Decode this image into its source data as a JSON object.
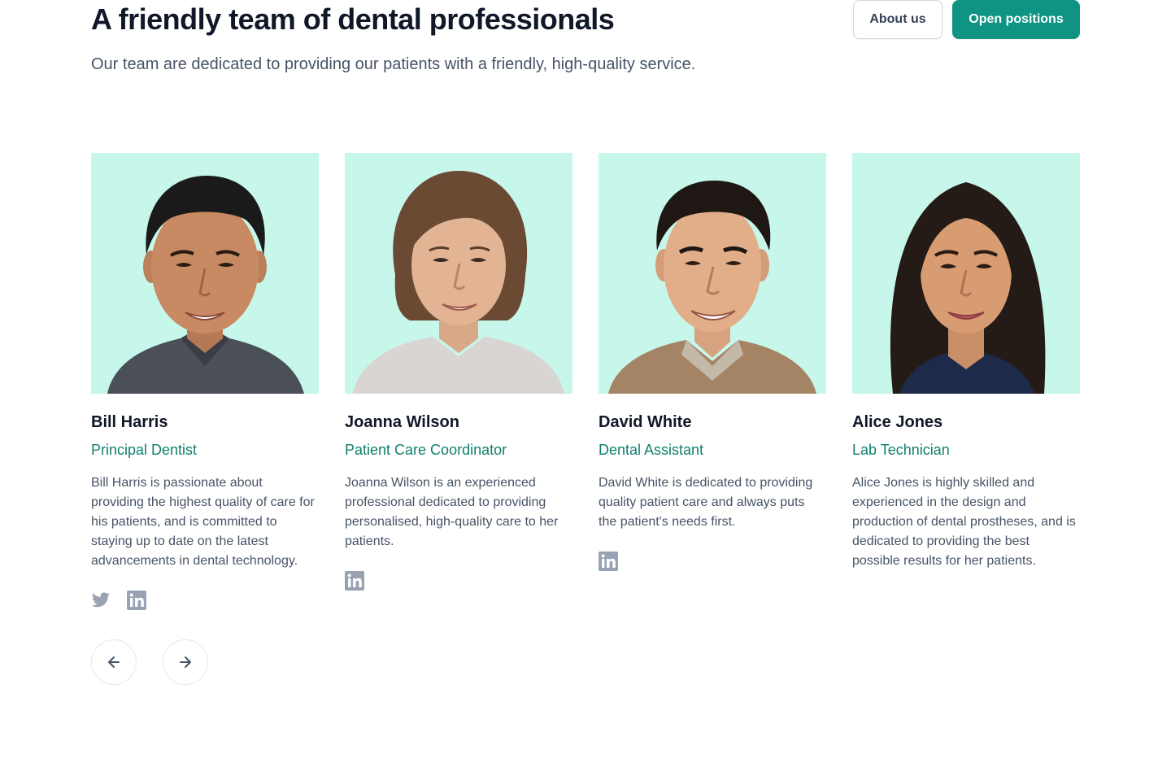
{
  "header": {
    "title": "A friendly team of dental professionals",
    "subtitle": "Our team are dedicated to providing our patients with a friendly, high-quality service.",
    "about_label": "About us",
    "open_positions_label": "Open positions"
  },
  "colors": {
    "accent": "#0f9483",
    "role_text": "#11806e",
    "photo_background": "#c6f7ea",
    "icon_gray": "#98a2b3"
  },
  "team": [
    {
      "name": "Bill Harris",
      "role": "Principal Dentist",
      "bio": "Bill Harris is passionate about providing the highest quality of care for his patients, and is committed to staying up to date on the latest advancements in dental technology.",
      "socials": [
        "twitter-icon",
        "linkedin-icon"
      ]
    },
    {
      "name": "Joanna Wilson",
      "role": "Patient Care Coordinator",
      "bio": "Joanna Wilson is an experienced professional dedicated to providing personalised, high-quality care to her patients.",
      "socials": [
        "linkedin-icon"
      ]
    },
    {
      "name": "David White",
      "role": "Dental Assistant",
      "bio": "David White is dedicated to providing quality patient care and always puts the patient's needs first.",
      "socials": [
        "linkedin-icon"
      ]
    },
    {
      "name": "Alice Jones",
      "role": "Lab Technician",
      "bio": "Alice Jones is highly skilled and experienced in the design and production of dental prostheses, and is dedicated to providing the best possible results for her patients.",
      "socials": []
    }
  ],
  "carousel": {
    "prev_icon": "arrow-left-icon",
    "next_icon": "arrow-right-icon"
  }
}
